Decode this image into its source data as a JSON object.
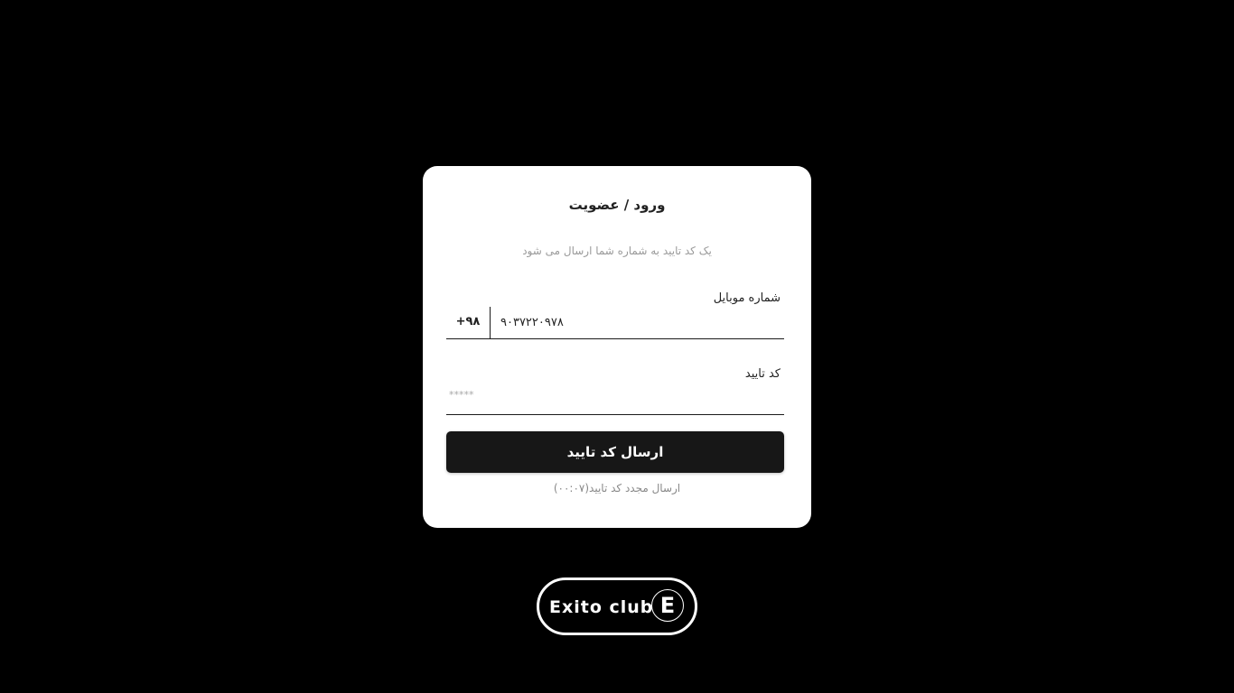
{
  "auth": {
    "title": "ورود / عضویت",
    "subtitle": "یک کد تایید به شماره شما ارسال می شود",
    "phone": {
      "label": "شماره موبایل",
      "prefix": "+۹۸",
      "value": "۹۰۳۷۲۲۰۹۷۸"
    },
    "code": {
      "label": "کد تایید",
      "placeholder": "*****"
    },
    "submit_label": "ارسال کد تایید",
    "resend_label": "ارسال مجدد کد تایید(۰۰:۰۷)"
  },
  "logo": {
    "text": "Exito club",
    "mark": "E"
  },
  "colors": {
    "background": "#000000",
    "card": "#ffffff",
    "button": "#171717",
    "muted_text": "#9a9a9a"
  }
}
